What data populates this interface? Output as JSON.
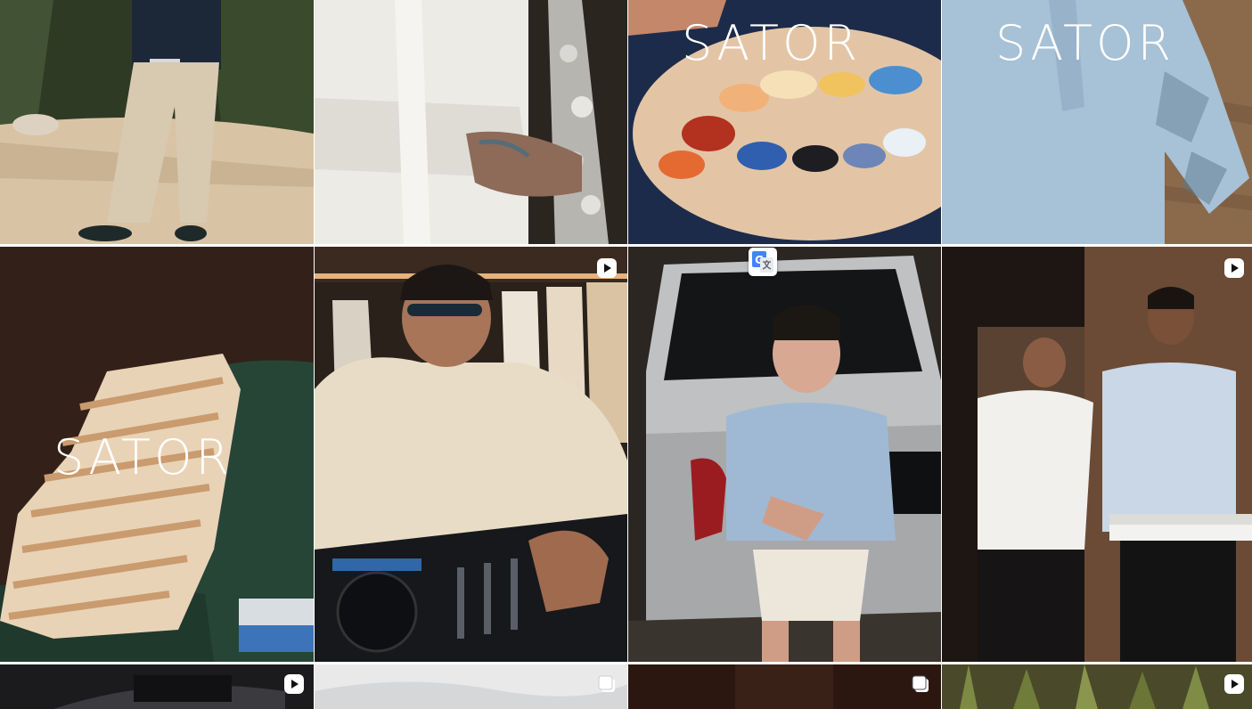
{
  "brand": {
    "wordmark": "SATOR"
  },
  "posts": [
    {
      "id": "post-man-camera-cactus",
      "overlay_text": "",
      "badge": "none"
    },
    {
      "id": "post-saxophone-hand",
      "overlay_text": "",
      "badge": "none"
    },
    {
      "id": "post-paint-palette",
      "overlay_text": "SATOR",
      "badge": "none"
    },
    {
      "id": "post-blue-shirt-flatlay",
      "overlay_text": "SATOR",
      "badge": "none"
    },
    {
      "id": "post-striped-shirt-chair",
      "overlay_text": "SATOR",
      "badge": "none"
    },
    {
      "id": "post-dj-mixer",
      "overlay_text": "",
      "badge": "reel-icon"
    },
    {
      "id": "post-car-trunk",
      "overlay_text": "",
      "badge": "none"
    },
    {
      "id": "post-keyboard-duo",
      "overlay_text": "",
      "badge": "reel-icon"
    },
    {
      "id": "post-row3-1",
      "overlay_text": "",
      "badge": "reel-icon"
    },
    {
      "id": "post-row3-2",
      "overlay_text": "",
      "badge": "carousel-icon"
    },
    {
      "id": "post-row3-3",
      "overlay_text": "",
      "badge": "carousel-icon"
    },
    {
      "id": "post-row3-4",
      "overlay_text": "",
      "badge": "reel-icon"
    }
  ],
  "overlay_widget": {
    "icon": "google-translate-icon"
  },
  "colors": {
    "badge": "#ffffff",
    "wordmark": "#ffffff",
    "gap": "#ffffff"
  }
}
